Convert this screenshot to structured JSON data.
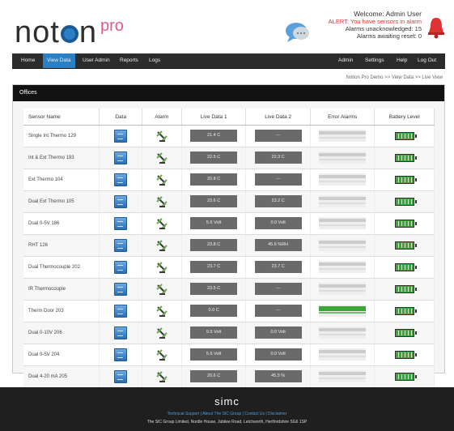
{
  "brand": {
    "name": "notion",
    "suffix": "pro"
  },
  "welcome": {
    "line1": "Welcome: Admin User",
    "line2": "ALERT: You have sensors in alarm",
    "line3": "Alarms unacknowledged: 15",
    "line4": "Alarms awaiting reset: 0"
  },
  "nav": {
    "items": [
      "Home",
      "View Data",
      "User Admin",
      "Reports",
      "Logs"
    ],
    "right_items": [
      "Admin",
      "Settings",
      "Help",
      "Log Out"
    ],
    "active": "View Data"
  },
  "breadcrumb": "Notion Pro Demo >> View Data >> Live View",
  "panel": {
    "title": "Offices"
  },
  "table": {
    "headers": [
      "Sensor Name",
      "Data",
      "Alarm",
      "Live Data 1",
      "Live Data 2",
      "Error Alarms",
      "Battery Level"
    ],
    "rows": [
      {
        "name": "Single Int Thermo 129",
        "live1": "21.4 C",
        "live2": "---",
        "err": "normal"
      },
      {
        "name": "Int & Ext Thermo 193",
        "live1": "22.5 C",
        "live2": "22.3 C",
        "err": "normal"
      },
      {
        "name": "Ext Thermo 104",
        "live1": "20.8 C",
        "live2": "---",
        "err": "normal"
      },
      {
        "name": "Dual Ext Thermo 105",
        "live1": "23.6 C",
        "live2": "23.2 C",
        "err": "normal"
      },
      {
        "name": "Dual 0-5V 186",
        "live1": "5.6 Volt",
        "live2": "0.0 Volt",
        "err": "normal"
      },
      {
        "name": "RHT 126",
        "live1": "23.8 C",
        "live2": "45.6 %RH",
        "err": "normal"
      },
      {
        "name": "Dual Thermocouple 202",
        "live1": "23.7 C",
        "live2": "23.7 C",
        "err": "normal"
      },
      {
        "name": "IR Thermocouple",
        "live1": "23.5 C",
        "live2": "---",
        "err": "normal"
      },
      {
        "name": "Therm Door 203",
        "live1": "0.0 C",
        "live2": "---",
        "err": "alarm"
      },
      {
        "name": "Dual 0-10V 206",
        "live1": "9.5 Volt",
        "live2": "0.0 Volt",
        "err": "normal"
      },
      {
        "name": "Dual 0-5V 204",
        "live1": "5.6 Volt",
        "live2": "0.0 Volt",
        "err": "normal"
      },
      {
        "name": "Dual 4-20 mA 205",
        "live1": "20.6 C",
        "live2": "45.5 %",
        "err": "normal"
      }
    ]
  },
  "footer": {
    "logo": "simc",
    "links": "Technical Support | About The SIC Group | Contact Us | Disclaimer",
    "address": "The SIC Group Limited, Nordle House, Jubilee Road, Letchworth, Hertfordshire SG6 1SP"
  },
  "colors": {
    "accent": "#2b7fc4",
    "alert": "#d33333",
    "battery": "#3aa635"
  },
  "icons": {
    "alarm": "satellite-antenna-icon",
    "data": "chart-icon",
    "battery": "battery-icon"
  }
}
